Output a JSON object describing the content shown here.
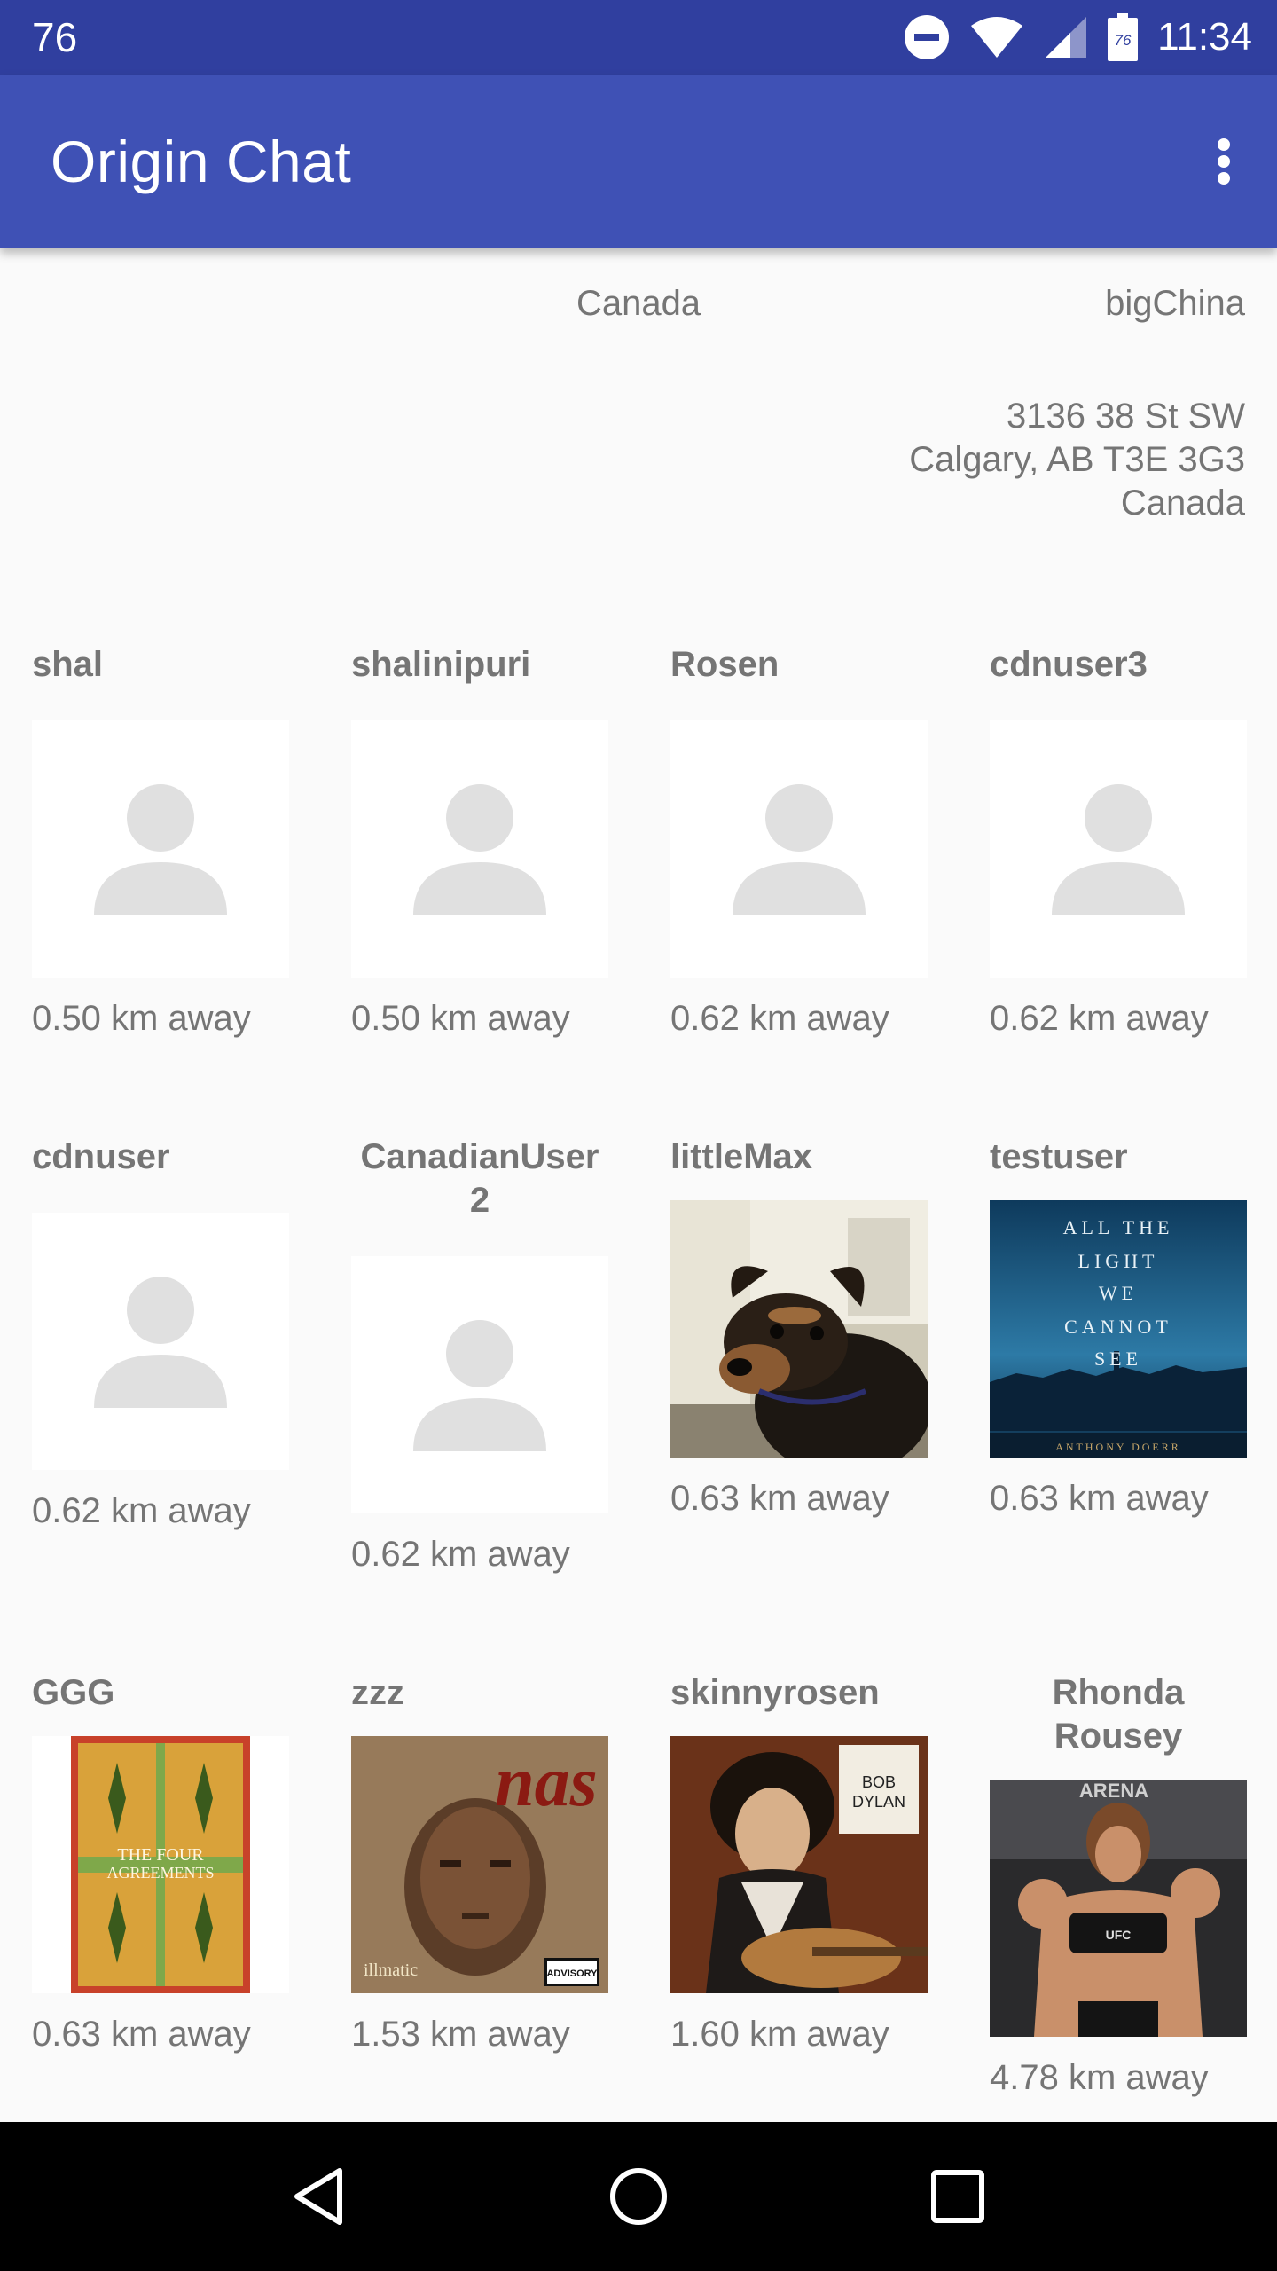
{
  "status_bar": {
    "left_text": "76",
    "battery_level": "76",
    "time": "11:34"
  },
  "app_bar": {
    "title": "Origin Chat",
    "menu_icon": "overflow-menu-icon"
  },
  "location": {
    "country": "Canada",
    "username": "bigChina",
    "address_lines": [
      "3136 38 St SW",
      "Calgary, AB T3E 3G3",
      "Canada"
    ]
  },
  "users": [
    {
      "name": "shal",
      "distance": "0.50 km away",
      "avatar": "default-avatar"
    },
    {
      "name": "shalinipuri",
      "distance": "0.50 km away",
      "avatar": "default-avatar"
    },
    {
      "name": "Rosen",
      "distance": "0.62 km away",
      "avatar": "default-avatar"
    },
    {
      "name": "cdnuser3",
      "distance": "0.62 km away",
      "avatar": "default-avatar"
    },
    {
      "name": "cdnuser",
      "distance": "0.62 km away",
      "avatar": "default-avatar"
    },
    {
      "name": "CanadianUser\n2",
      "distance": "0.62 km away",
      "avatar": "default-avatar"
    },
    {
      "name": "littleMax",
      "distance": "0.63 km away",
      "avatar": "dog-photo"
    },
    {
      "name": "testuser",
      "distance": "0.63 km away",
      "avatar": "book-cover-photo",
      "cover_text": [
        "ALL THE",
        "LIGHT",
        "WE",
        "CANNOT",
        "SEE"
      ],
      "cover_author": "ANTHONY DOERR"
    },
    {
      "name": "GGG",
      "distance": "0.63 km away",
      "avatar": "book-cover-photo",
      "cover_text": [
        "THE FOUR",
        "AGREEMENTS"
      ]
    },
    {
      "name": "zzz",
      "distance": "1.53 km away",
      "avatar": "album-cover-photo",
      "cover_text": [
        "nas"
      ],
      "cover_sub": "illmatic",
      "cover_badge": "ADVISORY"
    },
    {
      "name": "skinnyrosen",
      "distance": "1.60 km away",
      "avatar": "album-cover-photo",
      "cover_text": [
        "BOB",
        "DYLAN"
      ]
    },
    {
      "name": "Rhonda\nRousey",
      "distance": "4.78 km away",
      "avatar": "person-photo",
      "cover_text": [
        "ARENA"
      ],
      "cover_sub": "UFC"
    }
  ],
  "nav": {
    "back": "back-icon",
    "home": "home-icon",
    "recents": "recents-icon"
  }
}
